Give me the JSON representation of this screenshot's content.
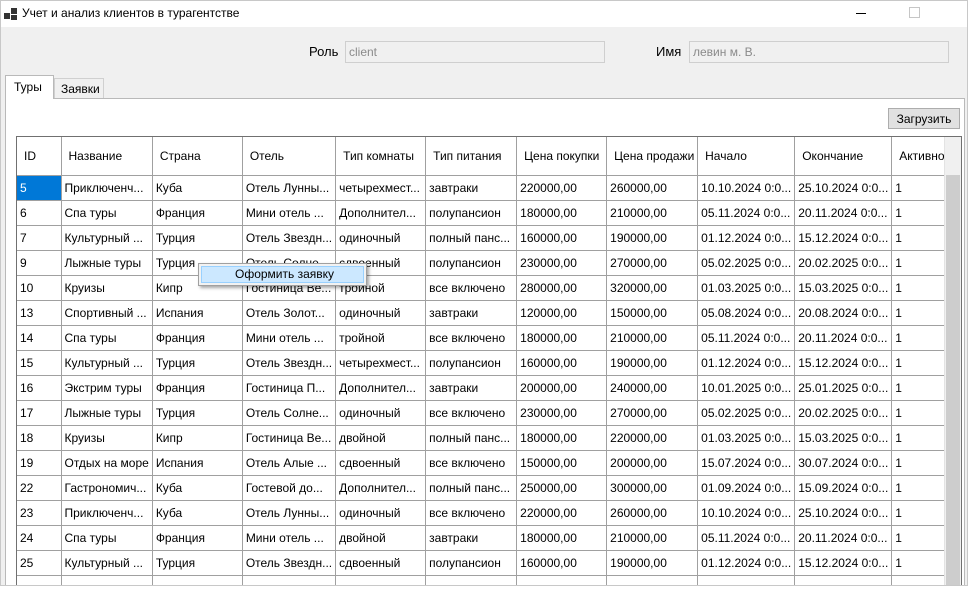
{
  "window": {
    "title": "Учет и анализ клиентов в турагентстве"
  },
  "form": {
    "role_label": "Роль",
    "role_value": "client",
    "name_label": "Имя",
    "name_value": "левин м. В."
  },
  "tabs": [
    {
      "label": "Туры",
      "active": true
    },
    {
      "label": "Заявки",
      "active": false
    }
  ],
  "toolbar": {
    "load_label": "Загрузить"
  },
  "table": {
    "columns": [
      "ID",
      "Название",
      "Страна",
      "Отель",
      "Тип комнаты",
      "Тип питания",
      "Цена покупки",
      "Цена продажи",
      "Начало",
      "Окончание",
      "Активно"
    ],
    "rows": [
      [
        "5",
        "Приключенч...",
        "Куба",
        "Отель Лунны...",
        "четырехмест...",
        "завтраки",
        "220000,00",
        "260000,00",
        "10.10.2024 0:0...",
        "25.10.2024 0:0...",
        "1"
      ],
      [
        "6",
        "Спа туры",
        "Франция",
        "Мини отель ...",
        "Дополнител...",
        "полупансион",
        "180000,00",
        "210000,00",
        "05.11.2024 0:0...",
        "20.11.2024 0:0...",
        "1"
      ],
      [
        "7",
        "Культурный ...",
        "Турция",
        "Отель Звездн...",
        "одиночный",
        "полный панс...",
        "160000,00",
        "190000,00",
        "01.12.2024 0:0...",
        "15.12.2024 0:0...",
        "1"
      ],
      [
        "9",
        "Лыжные туры",
        "Турция",
        "Отель Солне...",
        "сдвоенный",
        "полупансион",
        "230000,00",
        "270000,00",
        "05.02.2025 0:0...",
        "20.02.2025 0:0...",
        "1"
      ],
      [
        "10",
        "Круизы",
        "Кипр",
        "Гостиница Ве...",
        "тройной",
        "все включено",
        "280000,00",
        "320000,00",
        "01.03.2025 0:0...",
        "15.03.2025 0:0...",
        "1"
      ],
      [
        "13",
        "Спортивный ...",
        "Испания",
        "Отель Золот...",
        "одиночный",
        "завтраки",
        "120000,00",
        "150000,00",
        "05.08.2024 0:0...",
        "20.08.2024 0:0...",
        "1"
      ],
      [
        "14",
        "Спа туры",
        "Франция",
        "Мини отель ...",
        "тройной",
        "все включено",
        "180000,00",
        "210000,00",
        "05.11.2024 0:0...",
        "20.11.2024 0:0...",
        "1"
      ],
      [
        "15",
        "Культурный ...",
        "Турция",
        "Отель Звездн...",
        "четырехмест...",
        "полупансион",
        "160000,00",
        "190000,00",
        "01.12.2024 0:0...",
        "15.12.2024 0:0...",
        "1"
      ],
      [
        "16",
        "Экстрим туры",
        "Франция",
        "Гостиница П...",
        "Дополнител...",
        "завтраки",
        "200000,00",
        "240000,00",
        "10.01.2025 0:0...",
        "25.01.2025 0:0...",
        "1"
      ],
      [
        "17",
        "Лыжные туры",
        "Турция",
        "Отель Солне...",
        "одиночный",
        "все включено",
        "230000,00",
        "270000,00",
        "05.02.2025 0:0...",
        "20.02.2025 0:0...",
        "1"
      ],
      [
        "18",
        "Круизы",
        "Кипр",
        "Гостиница Ве...",
        "двойной",
        "полный панс...",
        "180000,00",
        "220000,00",
        "01.03.2025 0:0...",
        "15.03.2025 0:0...",
        "1"
      ],
      [
        "19",
        "Отдых на море",
        "Испания",
        "Отель Алые ...",
        "сдвоенный",
        "все включено",
        "150000,00",
        "200000,00",
        "15.07.2024 0:0...",
        "30.07.2024 0:0...",
        "1"
      ],
      [
        "22",
        "Гастрономич...",
        "Куба",
        "Гостевой до...",
        "Дополнител...",
        "полный панс...",
        "250000,00",
        "300000,00",
        "01.09.2024 0:0...",
        "15.09.2024 0:0...",
        "1"
      ],
      [
        "23",
        "Приключенч...",
        "Куба",
        "Отель Лунны...",
        "одиночный",
        "все включено",
        "220000,00",
        "260000,00",
        "10.10.2024 0:0...",
        "25.10.2024 0:0...",
        "1"
      ],
      [
        "24",
        "Спа туры",
        "Франция",
        "Мини отель ...",
        "двойной",
        "завтраки",
        "180000,00",
        "210000,00",
        "05.11.2024 0:0...",
        "20.11.2024 0:0...",
        "1"
      ],
      [
        "25",
        "Культурный ...",
        "Турция",
        "Отель Звездн...",
        "сдвоенный",
        "полупансион",
        "160000,00",
        "190000,00",
        "01.12.2024 0:0...",
        "15.12.2024 0:0...",
        "1"
      ],
      [
        "",
        "",
        "",
        "",
        "",
        "",
        "",
        "",
        "",
        "",
        ""
      ]
    ]
  },
  "context_menu": {
    "item_label": "Оформить заявку"
  },
  "icons": {
    "app": "app-windows-icon",
    "minimize": "minimize-icon",
    "maximize": "maximize-icon"
  },
  "colors": {
    "selection": "#0078d7",
    "menu_highlight": "#cce8ff"
  }
}
